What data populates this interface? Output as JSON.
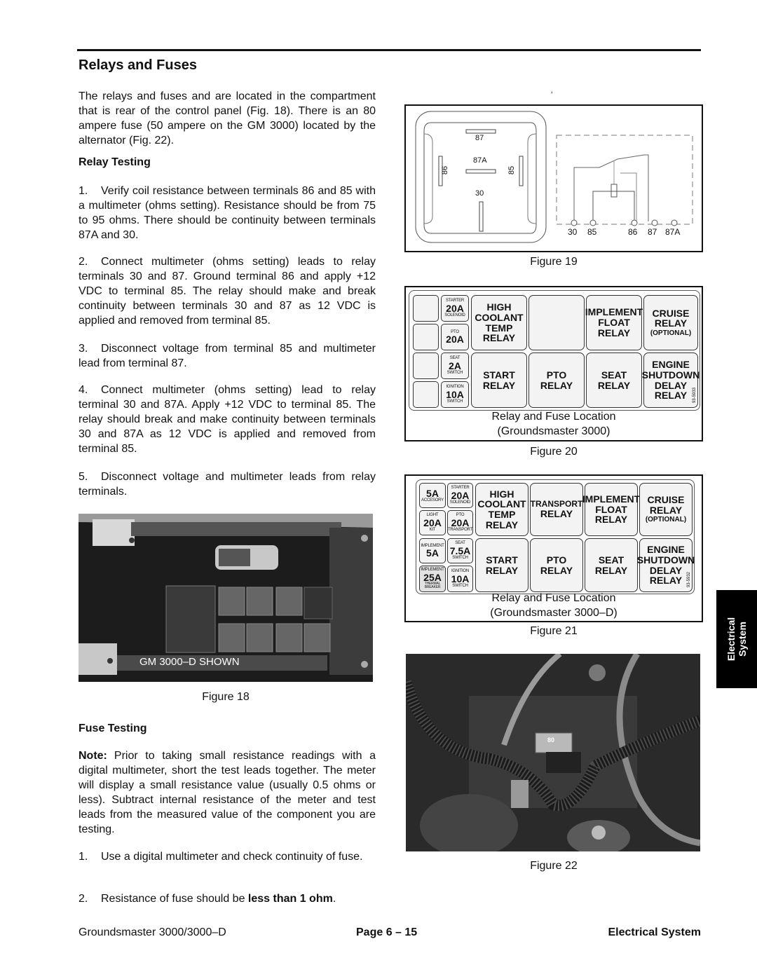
{
  "section_title": "Relays and Fuses",
  "intro": "The relays and fuses and are located in the compartment that is rear of the control panel (Fig. 18). There is an 80 ampere fuse (50 ampere on the GM 3000) located by the alternator (Fig. 22).",
  "relay_testing": {
    "heading": "Relay Testing",
    "steps": [
      {
        "num": "1.",
        "text": "Verify coil resistance between terminals 86 and 85 with a multimeter (ohms setting). Resistance should be from 75 to 95 ohms. There should be continuity between terminals 87A and 30."
      },
      {
        "num": "2.",
        "text": "Connect multimeter (ohms setting) leads to relay terminals 30 and 87. Ground terminal 86 and apply +12 VDC to terminal 85. The relay should make and break continuity between terminals 30 and 87 as 12 VDC is applied and removed from terminal 85."
      },
      {
        "num": "3.",
        "text": "Disconnect voltage from terminal 85 and multimeter lead from terminal 87."
      },
      {
        "num": "4.",
        "text": "Connect multimeter (ohms setting) lead to relay terminal 30 and 87A. Apply +12 VDC to terminal 85. The relay should break and make continuity between terminals 30 and 87A as 12 VDC is applied and removed from terminal 85."
      },
      {
        "num": "5.",
        "text": "Disconnect voltage and multimeter leads from relay terminals."
      }
    ]
  },
  "figure18": {
    "photo_label": "GM 3000–D SHOWN",
    "caption": "Figure 18"
  },
  "fuse_testing": {
    "heading": "Fuse Testing",
    "note_label": "Note:",
    "note_text": "Prior to taking small resistance readings with a digital multimeter, short the test leads together. The meter will display a small resistance value (usually 0.5 ohms or less). Subtract internal resistance of the meter and test leads from the measured value of the component you are testing.",
    "steps": [
      {
        "num": "1.",
        "text": "Use a digital multimeter and check continuity of fuse."
      },
      {
        "num": "2.",
        "text_before": "Resistance of fuse should be ",
        "text_bold": "less than 1 ohm",
        "text_after": "."
      }
    ]
  },
  "figure19": {
    "stray_mark": "‘",
    "pins": {
      "p87": "87",
      "p87A": "87A",
      "p86": "86",
      "p85": "85",
      "p30": "30"
    },
    "schematic_terminals": [
      "30",
      "85",
      "86",
      "87",
      "87A"
    ],
    "caption": "Figure 19"
  },
  "figure20": {
    "fuses": [
      {
        "top": "",
        "amp": "",
        "bottom": ""
      },
      {
        "top": "STARTER",
        "amp": "20A",
        "bottom": "SOLENOID"
      },
      {
        "top": "",
        "amp": "",
        "bottom": ""
      },
      {
        "top": "PTO",
        "amp": "20A",
        "bottom": ""
      },
      {
        "top": "",
        "amp": "",
        "bottom": ""
      },
      {
        "top": "SEAT",
        "amp": "2A",
        "bottom": "SWITCH"
      },
      {
        "top": "",
        "amp": "",
        "bottom": ""
      },
      {
        "top": "IGNITION",
        "amp": "10A",
        "bottom": "SWITCH"
      }
    ],
    "relays": [
      [
        "HIGH",
        "COOLANT",
        "TEMP",
        "RELAY"
      ],
      [],
      [
        "IMPLEMENT",
        "FLOAT",
        "RELAY"
      ],
      [
        "CRUISE",
        "RELAY"
      ],
      [
        "START",
        "RELAY"
      ],
      [
        "PTO",
        "RELAY"
      ],
      [
        "SEAT",
        "RELAY"
      ],
      [
        "ENGINE",
        "SHUTDOWN",
        "DELAY",
        "RELAY"
      ]
    ],
    "optional_label": "(OPTIONAL)",
    "part_number": "93-5933",
    "caption_line1": "Relay and Fuse Location",
    "caption_line2": "(Groundsmaster 3000)",
    "caption": "Figure 20"
  },
  "figure21": {
    "fuses": [
      {
        "top": "",
        "amp": "5A",
        "bottom": "ACCESORY"
      },
      {
        "top": "STARTER",
        "amp": "20A",
        "bottom": "SOLENOID"
      },
      {
        "top": "LIGHT",
        "amp": "20A",
        "bottom": "KIT"
      },
      {
        "top": "PTO",
        "amp": "20A",
        "bottom": "TRANSPORT"
      },
      {
        "top": "IMPLEMENT",
        "amp": "5A",
        "bottom": ""
      },
      {
        "top": "SEAT",
        "amp": "7.5A",
        "bottom": "SWITCH"
      },
      {
        "top": "IMPLEMENT",
        "amp": "25A",
        "bottom": "THERMAL BREAKER"
      },
      {
        "top": "IGNITION",
        "amp": "10A",
        "bottom": "SWITCH"
      }
    ],
    "relays": [
      [
        "HIGH",
        "COOLANT",
        "TEMP",
        "RELAY"
      ],
      [
        "TRANSPORT",
        "RELAY"
      ],
      [
        "IMPLEMENT",
        "FLOAT",
        "RELAY"
      ],
      [
        "CRUISE",
        "RELAY"
      ],
      [
        "START",
        "RELAY"
      ],
      [
        "PTO",
        "RELAY"
      ],
      [
        "SEAT",
        "RELAY"
      ],
      [
        "ENGINE",
        "SHUTDOWN",
        "DELAY",
        "RELAY"
      ]
    ],
    "optional_label": "(OPTIONAL)",
    "part_number": "93-5932",
    "caption_line1": "Relay and Fuse Location",
    "caption_line2": "(Groundsmaster 3000–D)",
    "caption": "Figure 21"
  },
  "figure22": {
    "fuse_marking": "80",
    "caption": "Figure 22"
  },
  "side_tab": {
    "line1": "Electrical",
    "line2": "System"
  },
  "footer": {
    "left": "Groundsmaster 3000/3000–D",
    "center": "Page 6 – 15",
    "right": "Electrical System"
  }
}
